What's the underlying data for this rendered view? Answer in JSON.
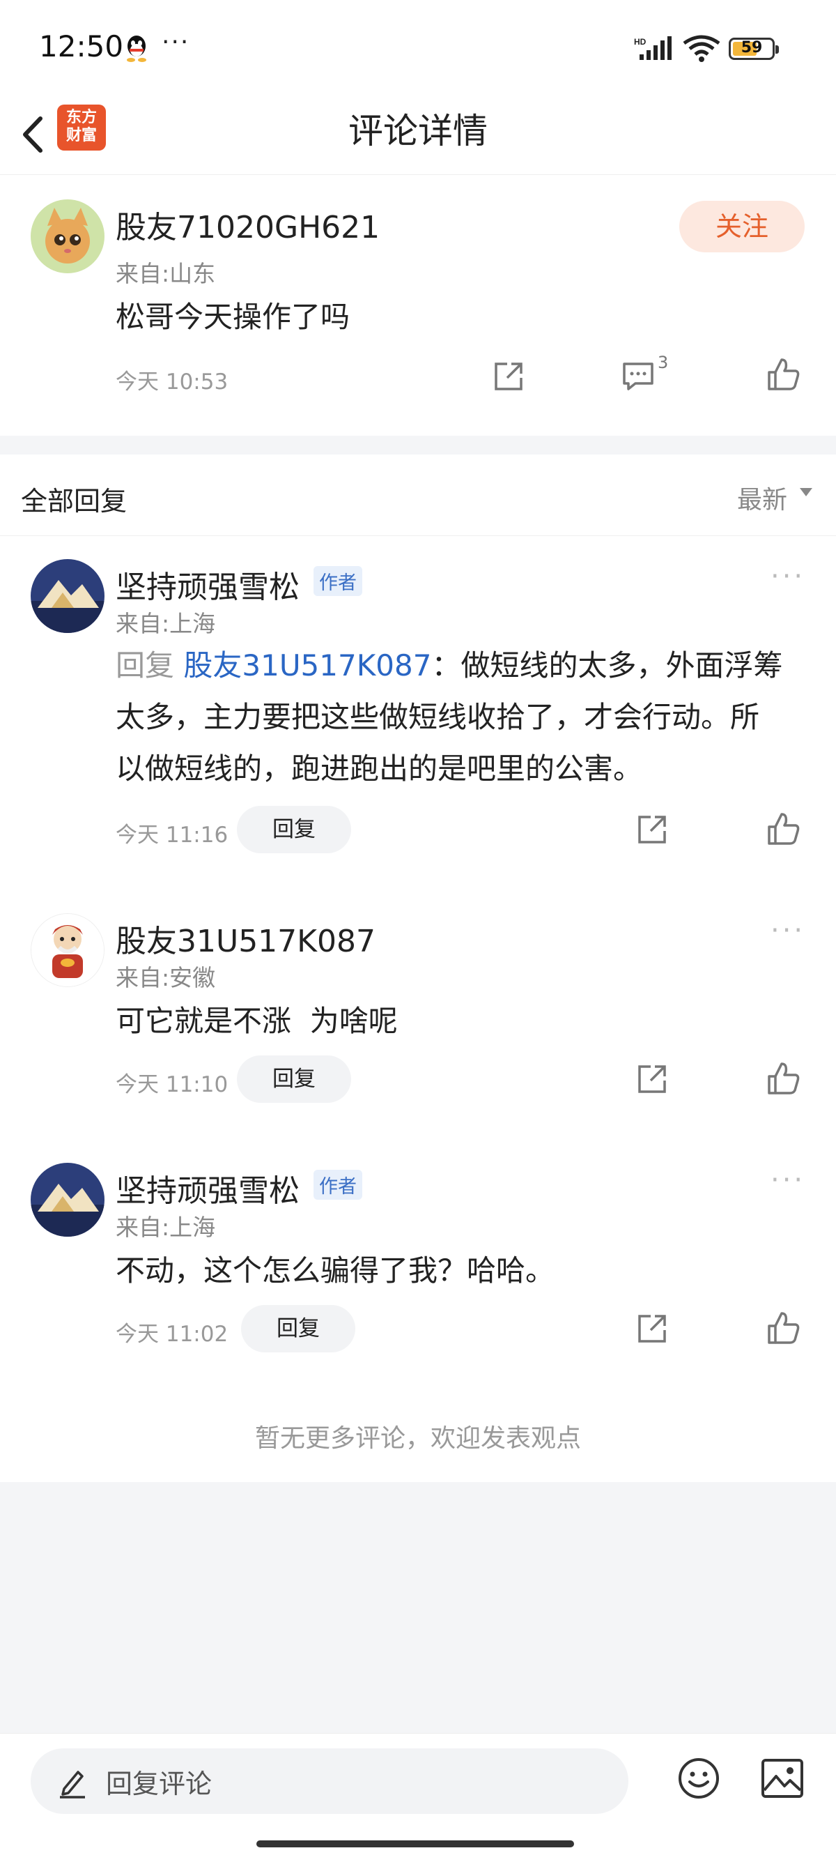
{
  "status_bar": {
    "time": "12:50",
    "battery": "59"
  },
  "header": {
    "title": "评论详情",
    "logo_text_1": "东方",
    "logo_text_2": "财富"
  },
  "post": {
    "username": "股友71020GH621",
    "from": "来自:山东",
    "content": "松哥今天操作了吗",
    "time": "今天 10:53",
    "follow": "关注",
    "comment_count": "3"
  },
  "section": {
    "title": "全部回复",
    "sort": "最新"
  },
  "replies": [
    {
      "username": "坚持顽强雪松",
      "badge": "作者",
      "from": "来自:上海",
      "reply_prefix": "回复",
      "mention": "股友31U517K087",
      "line1_rest": "：做短线的太多，外面浮筹",
      "line2": "太多，主力要把这些做短线收拾了，才会行动。所",
      "line3": "以做短线的，跑进跑出的是吧里的公害。",
      "time": "今天 11:16",
      "reply_btn": "回复"
    },
    {
      "username": "股友31U517K087",
      "from": "来自:安徽",
      "content": "可它就是不涨  为啥呢",
      "time": "今天 11:10",
      "reply_btn": "回复"
    },
    {
      "username": "坚持顽强雪松",
      "badge": "作者",
      "from": "来自:上海",
      "content": "不动，这个怎么骗得了我？哈哈。",
      "time": "今天 11:02",
      "reply_btn": "回复"
    }
  ],
  "footer_note": "暂无更多评论，欢迎发表观点",
  "bottom": {
    "placeholder": "回复评论"
  }
}
